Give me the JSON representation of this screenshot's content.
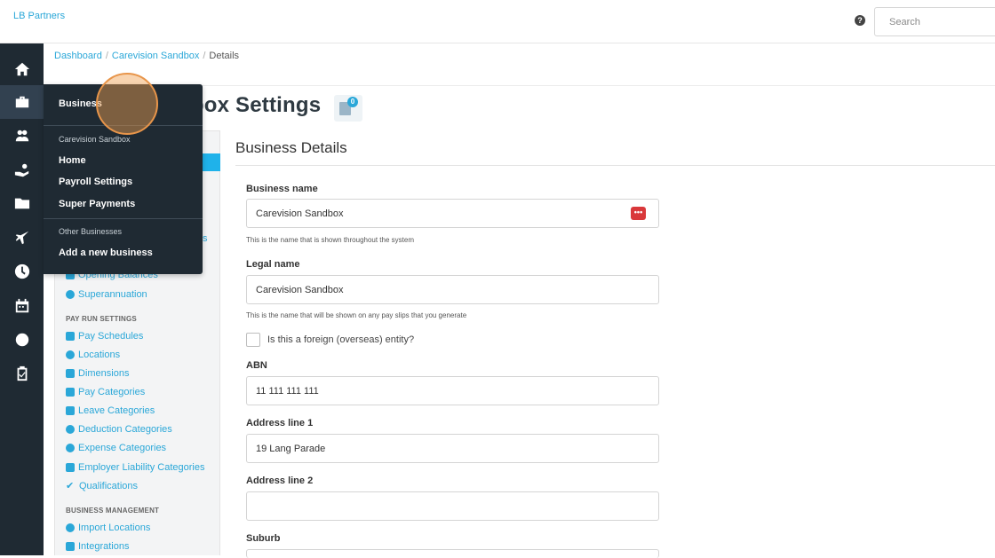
{
  "app": {
    "org_name": "LB Partners"
  },
  "header": {
    "help_icon": "question-circle-icon",
    "help_glyph": "?",
    "search_placeholder": "Search"
  },
  "rail": [
    {
      "icon": "home-icon"
    },
    {
      "icon": "briefcase-icon"
    },
    {
      "icon": "people-icon"
    },
    {
      "icon": "hand-coin-icon"
    },
    {
      "icon": "folder-icon"
    },
    {
      "icon": "plane-icon"
    },
    {
      "icon": "clock-icon"
    },
    {
      "icon": "calendar-icon"
    },
    {
      "icon": "money-icon"
    },
    {
      "icon": "clipboard-check-icon"
    }
  ],
  "breadcrumb": {
    "items": [
      "Dashboard",
      "Carevision Sandbox"
    ],
    "current": "Details",
    "separator": "/"
  },
  "page": {
    "title_visible": "dbox Settings",
    "doc_count": "0"
  },
  "dropdown": {
    "header": "Business",
    "current_business": "Carevision Sandbox",
    "items": [
      "Home",
      "Payroll Settings",
      "Super Payments"
    ],
    "other_label": "Other Businesses",
    "add_label": "Add a new business"
  },
  "settings_nav": {
    "peek_text": "s",
    "partial_item": "Opening Balances",
    "superannuation": "Superannuation",
    "pay_run_section": "PAY RUN SETTINGS",
    "pay_run_items": [
      "Pay Schedules",
      "Locations",
      "Dimensions",
      "Pay Categories",
      "Leave Categories",
      "Deduction Categories",
      "Expense Categories",
      "Employer Liability Categories",
      "Qualifications"
    ],
    "business_mgmt_section": "BUSINESS MANAGEMENT",
    "business_mgmt_items": [
      "Import Locations",
      "Integrations"
    ]
  },
  "form": {
    "section_title": "Business Details",
    "business_name_label": "Business name",
    "business_name_value": "Carevision Sandbox",
    "business_name_help": "This is the name that is shown throughout the system",
    "pw_icon_glyph": "•••",
    "legal_name_label": "Legal name",
    "legal_name_value": "Carevision Sandbox",
    "legal_name_help": "This is the name that will be shown on any pay slips that you generate",
    "foreign_label": "Is this a foreign (overseas) entity?",
    "abn_label": "ABN",
    "abn_value": "11 111 111 111",
    "address1_label": "Address line 1",
    "address1_value": "19 Lang Parade",
    "address2_label": "Address line 2",
    "address2_value": "",
    "suburb_label": "Suburb"
  }
}
